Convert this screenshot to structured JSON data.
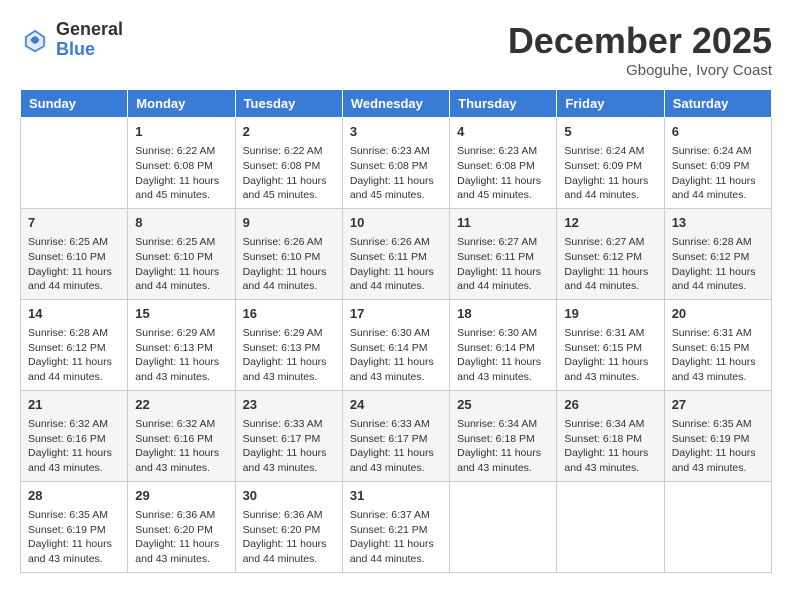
{
  "header": {
    "logo_general": "General",
    "logo_blue": "Blue",
    "month_title": "December 2025",
    "location": "Gboguhe, Ivory Coast"
  },
  "weekdays": [
    "Sunday",
    "Monday",
    "Tuesday",
    "Wednesday",
    "Thursday",
    "Friday",
    "Saturday"
  ],
  "weeks": [
    [
      {
        "day": "",
        "info": ""
      },
      {
        "day": "1",
        "info": "Sunrise: 6:22 AM\nSunset: 6:08 PM\nDaylight: 11 hours\nand 45 minutes."
      },
      {
        "day": "2",
        "info": "Sunrise: 6:22 AM\nSunset: 6:08 PM\nDaylight: 11 hours\nand 45 minutes."
      },
      {
        "day": "3",
        "info": "Sunrise: 6:23 AM\nSunset: 6:08 PM\nDaylight: 11 hours\nand 45 minutes."
      },
      {
        "day": "4",
        "info": "Sunrise: 6:23 AM\nSunset: 6:08 PM\nDaylight: 11 hours\nand 45 minutes."
      },
      {
        "day": "5",
        "info": "Sunrise: 6:24 AM\nSunset: 6:09 PM\nDaylight: 11 hours\nand 44 minutes."
      },
      {
        "day": "6",
        "info": "Sunrise: 6:24 AM\nSunset: 6:09 PM\nDaylight: 11 hours\nand 44 minutes."
      }
    ],
    [
      {
        "day": "7",
        "info": "Sunrise: 6:25 AM\nSunset: 6:10 PM\nDaylight: 11 hours\nand 44 minutes."
      },
      {
        "day": "8",
        "info": "Sunrise: 6:25 AM\nSunset: 6:10 PM\nDaylight: 11 hours\nand 44 minutes."
      },
      {
        "day": "9",
        "info": "Sunrise: 6:26 AM\nSunset: 6:10 PM\nDaylight: 11 hours\nand 44 minutes."
      },
      {
        "day": "10",
        "info": "Sunrise: 6:26 AM\nSunset: 6:11 PM\nDaylight: 11 hours\nand 44 minutes."
      },
      {
        "day": "11",
        "info": "Sunrise: 6:27 AM\nSunset: 6:11 PM\nDaylight: 11 hours\nand 44 minutes."
      },
      {
        "day": "12",
        "info": "Sunrise: 6:27 AM\nSunset: 6:12 PM\nDaylight: 11 hours\nand 44 minutes."
      },
      {
        "day": "13",
        "info": "Sunrise: 6:28 AM\nSunset: 6:12 PM\nDaylight: 11 hours\nand 44 minutes."
      }
    ],
    [
      {
        "day": "14",
        "info": "Sunrise: 6:28 AM\nSunset: 6:12 PM\nDaylight: 11 hours\nand 44 minutes."
      },
      {
        "day": "15",
        "info": "Sunrise: 6:29 AM\nSunset: 6:13 PM\nDaylight: 11 hours\nand 43 minutes."
      },
      {
        "day": "16",
        "info": "Sunrise: 6:29 AM\nSunset: 6:13 PM\nDaylight: 11 hours\nand 43 minutes."
      },
      {
        "day": "17",
        "info": "Sunrise: 6:30 AM\nSunset: 6:14 PM\nDaylight: 11 hours\nand 43 minutes."
      },
      {
        "day": "18",
        "info": "Sunrise: 6:30 AM\nSunset: 6:14 PM\nDaylight: 11 hours\nand 43 minutes."
      },
      {
        "day": "19",
        "info": "Sunrise: 6:31 AM\nSunset: 6:15 PM\nDaylight: 11 hours\nand 43 minutes."
      },
      {
        "day": "20",
        "info": "Sunrise: 6:31 AM\nSunset: 6:15 PM\nDaylight: 11 hours\nand 43 minutes."
      }
    ],
    [
      {
        "day": "21",
        "info": "Sunrise: 6:32 AM\nSunset: 6:16 PM\nDaylight: 11 hours\nand 43 minutes."
      },
      {
        "day": "22",
        "info": "Sunrise: 6:32 AM\nSunset: 6:16 PM\nDaylight: 11 hours\nand 43 minutes."
      },
      {
        "day": "23",
        "info": "Sunrise: 6:33 AM\nSunset: 6:17 PM\nDaylight: 11 hours\nand 43 minutes."
      },
      {
        "day": "24",
        "info": "Sunrise: 6:33 AM\nSunset: 6:17 PM\nDaylight: 11 hours\nand 43 minutes."
      },
      {
        "day": "25",
        "info": "Sunrise: 6:34 AM\nSunset: 6:18 PM\nDaylight: 11 hours\nand 43 minutes."
      },
      {
        "day": "26",
        "info": "Sunrise: 6:34 AM\nSunset: 6:18 PM\nDaylight: 11 hours\nand 43 minutes."
      },
      {
        "day": "27",
        "info": "Sunrise: 6:35 AM\nSunset: 6:19 PM\nDaylight: 11 hours\nand 43 minutes."
      }
    ],
    [
      {
        "day": "28",
        "info": "Sunrise: 6:35 AM\nSunset: 6:19 PM\nDaylight: 11 hours\nand 43 minutes."
      },
      {
        "day": "29",
        "info": "Sunrise: 6:36 AM\nSunset: 6:20 PM\nDaylight: 11 hours\nand 43 minutes."
      },
      {
        "day": "30",
        "info": "Sunrise: 6:36 AM\nSunset: 6:20 PM\nDaylight: 11 hours\nand 44 minutes."
      },
      {
        "day": "31",
        "info": "Sunrise: 6:37 AM\nSunset: 6:21 PM\nDaylight: 11 hours\nand 44 minutes."
      },
      {
        "day": "",
        "info": ""
      },
      {
        "day": "",
        "info": ""
      },
      {
        "day": "",
        "info": ""
      }
    ]
  ]
}
